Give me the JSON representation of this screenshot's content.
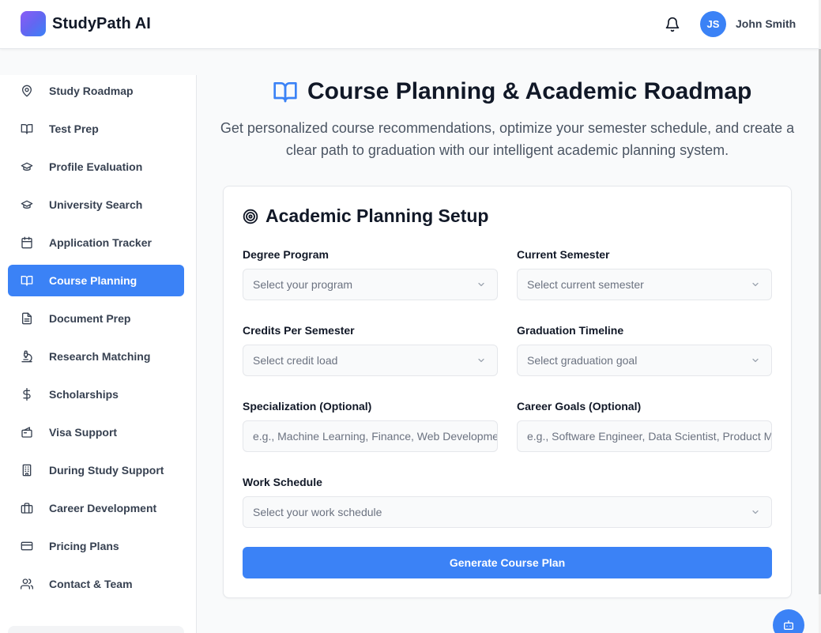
{
  "app": {
    "name": "StudyPath AI"
  },
  "header": {
    "user": {
      "initials": "JS",
      "name": "John Smith"
    }
  },
  "sidebar": {
    "items": [
      {
        "label": "Study Roadmap",
        "icon": "map-pin-icon",
        "active": false
      },
      {
        "label": "Test Prep",
        "icon": "book-open-icon",
        "active": false
      },
      {
        "label": "Profile Evaluation",
        "icon": "graduation-cap-icon",
        "active": false
      },
      {
        "label": "University Search",
        "icon": "graduation-cap-icon",
        "active": false
      },
      {
        "label": "Application Tracker",
        "icon": "calendar-icon",
        "active": false
      },
      {
        "label": "Course Planning",
        "icon": "book-open-icon",
        "active": true
      },
      {
        "label": "Document Prep",
        "icon": "document-icon",
        "active": false
      },
      {
        "label": "Research Matching",
        "icon": "microscope-icon",
        "active": false
      },
      {
        "label": "Scholarships",
        "icon": "dollar-icon",
        "active": false
      },
      {
        "label": "Visa Support",
        "icon": "passport-icon",
        "active": false
      },
      {
        "label": "During Study Support",
        "icon": "building-icon",
        "active": false
      },
      {
        "label": "Career Development",
        "icon": "briefcase-icon",
        "active": false
      },
      {
        "label": "Pricing Plans",
        "icon": "credit-card-icon",
        "active": false
      },
      {
        "label": "Contact & Team",
        "icon": "users-icon",
        "active": false
      }
    ]
  },
  "main": {
    "title": "Course Planning & Academic Roadmap",
    "subtitle": "Get personalized course recommendations, optimize your semester schedule, and create a clear path to graduation with our intelligent academic planning system.",
    "card": {
      "title": "Academic Planning Setup",
      "fields": {
        "degree_program": {
          "label": "Degree Program",
          "placeholder": "Select your program"
        },
        "current_semester": {
          "label": "Current Semester",
          "placeholder": "Select current semester"
        },
        "credits_per_semester": {
          "label": "Credits Per Semester",
          "placeholder": "Select credit load"
        },
        "graduation_timeline": {
          "label": "Graduation Timeline",
          "placeholder": "Select graduation goal"
        },
        "specialization": {
          "label": "Specialization (Optional)",
          "placeholder": "e.g., Machine Learning, Finance, Web Development"
        },
        "career_goals": {
          "label": "Career Goals (Optional)",
          "placeholder": "e.g., Software Engineer, Data Scientist, Product Manager"
        },
        "work_schedule": {
          "label": "Work Schedule",
          "placeholder": "Select your work schedule"
        }
      },
      "submit_label": "Generate Course Plan"
    }
  },
  "colors": {
    "accent": "#3b82f6",
    "text": "#111827",
    "muted": "#6b7280"
  }
}
